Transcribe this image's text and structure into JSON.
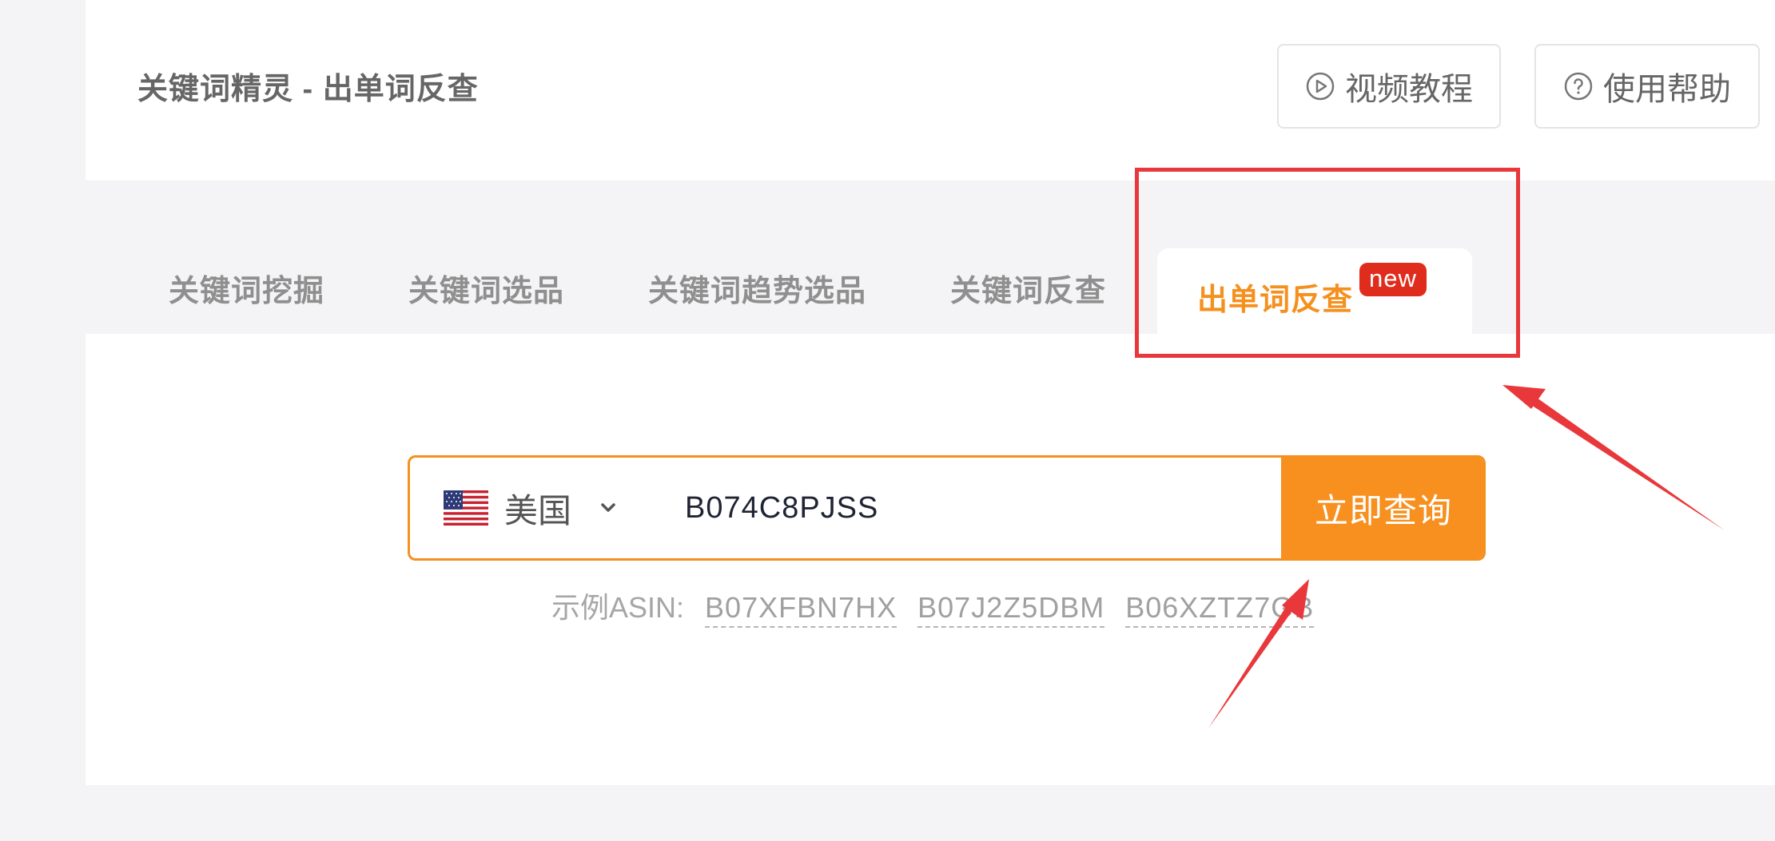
{
  "header": {
    "title": "关键词精灵 - 出单词反查",
    "video_button": "视频教程",
    "help_button": "使用帮助"
  },
  "tabs": [
    {
      "label": "关键词挖掘"
    },
    {
      "label": "关键词选品"
    },
    {
      "label": "关键词趋势选品"
    },
    {
      "label": "关键词反查"
    },
    {
      "label": "出单词反查",
      "badge": "new",
      "active": true
    }
  ],
  "search": {
    "country": "美国",
    "asin_value": "B074C8PJSS",
    "submit_label": "立即查询"
  },
  "examples": {
    "label": "示例ASIN:",
    "items": [
      "B07XFBN7HX",
      "B07J2Z5DBM",
      "B06XZTZ7GB"
    ]
  },
  "colors": {
    "accent": "#f7901f",
    "badge": "#e02c1c",
    "annotation": "#e8383b"
  }
}
